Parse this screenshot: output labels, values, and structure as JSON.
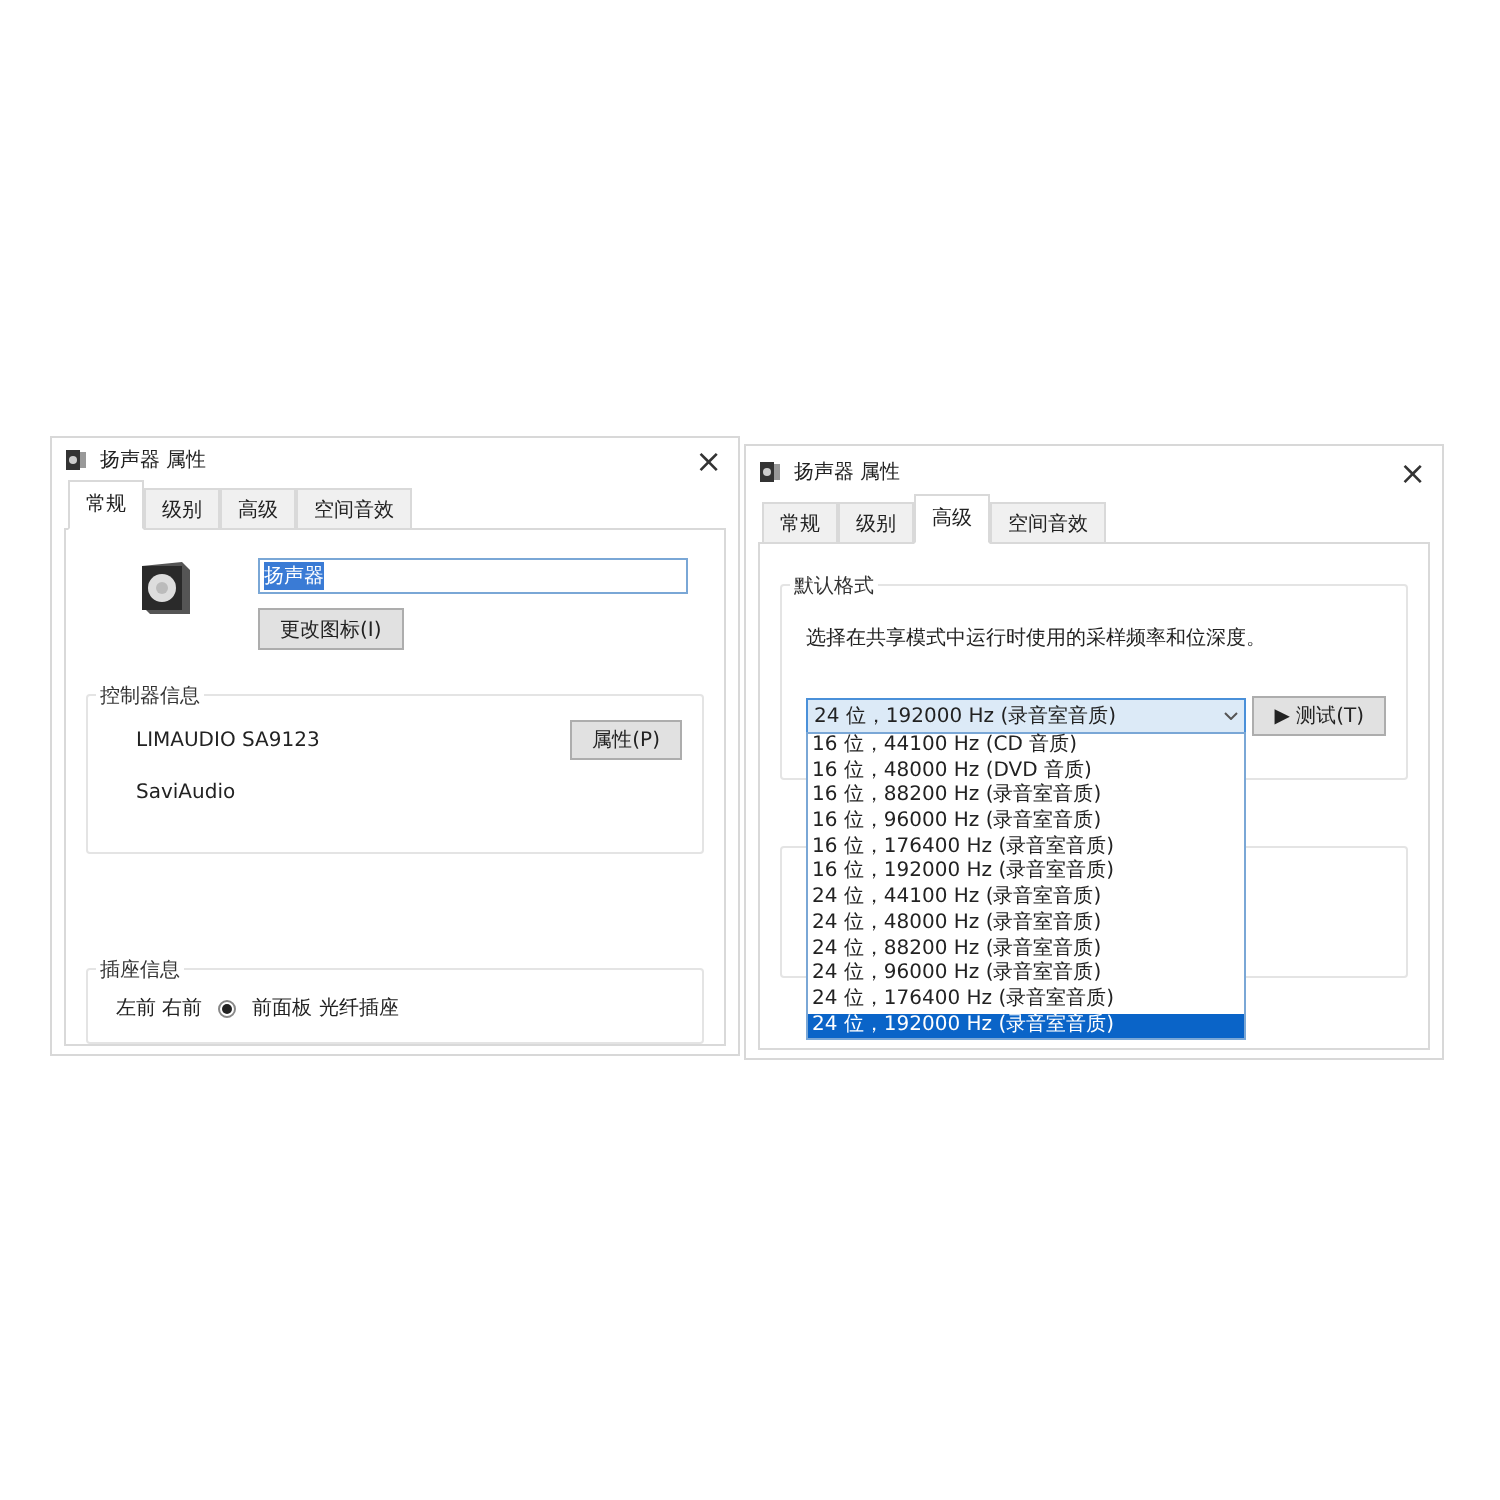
{
  "general_window": {
    "title": "扬声器 属性",
    "close": "×",
    "tabs": [
      {
        "label": "常规",
        "selected": true
      },
      {
        "label": "级别",
        "selected": false
      },
      {
        "label": "高级",
        "selected": false
      },
      {
        "label": "空间音效",
        "selected": false
      }
    ],
    "device_name": {
      "value": "扬声器",
      "selected": true
    },
    "change_icon_button": "更改图标(I)",
    "controller": {
      "title": "控制器信息",
      "name": "LIMAUDIO SA9123",
      "vendor": "SaviAudio",
      "properties_button": "属性(P)"
    },
    "jack": {
      "title": "插座信息",
      "channels": "左前 右前",
      "connector": "前面板 光纤插座"
    }
  },
  "advanced_window": {
    "title": "扬声器 属性",
    "close": "×",
    "tabs": [
      {
        "label": "常规",
        "selected": false
      },
      {
        "label": "级别",
        "selected": false
      },
      {
        "label": "高级",
        "selected": true
      },
      {
        "label": "空间音效",
        "selected": false
      }
    ],
    "default_format": {
      "title": "默认格式",
      "description": "选择在共享模式中运行时使用的采样频率和位深度。",
      "value": "24 位，192000 Hz (录音室音质)",
      "test_button": "▶ 测试(T)",
      "expanded": true,
      "options": [
        {
          "label": "16 位，44100 Hz (CD 音质)",
          "selected": false
        },
        {
          "label": "16 位，48000 Hz (DVD 音质)",
          "selected": false
        },
        {
          "label": "16 位，88200 Hz (录音室音质)",
          "selected": false
        },
        {
          "label": "16 位，96000 Hz (录音室音质)",
          "selected": false
        },
        {
          "label": "16 位，176400 Hz (录音室音质)",
          "selected": false
        },
        {
          "label": "16 位，192000 Hz (录音室音质)",
          "selected": false
        },
        {
          "label": "24 位，44100 Hz (录音室音质)",
          "selected": false
        },
        {
          "label": "24 位，48000 Hz (录音室音质)",
          "selected": false
        },
        {
          "label": "24 位，88200 Hz (录音室音质)",
          "selected": false
        },
        {
          "label": "24 位，96000 Hz (录音室音质)",
          "selected": false
        },
        {
          "label": "24 位，176400 Hz (录音室音质)",
          "selected": false
        },
        {
          "label": "24 位，192000 Hz (录音室音质)",
          "selected": true
        }
      ]
    }
  }
}
